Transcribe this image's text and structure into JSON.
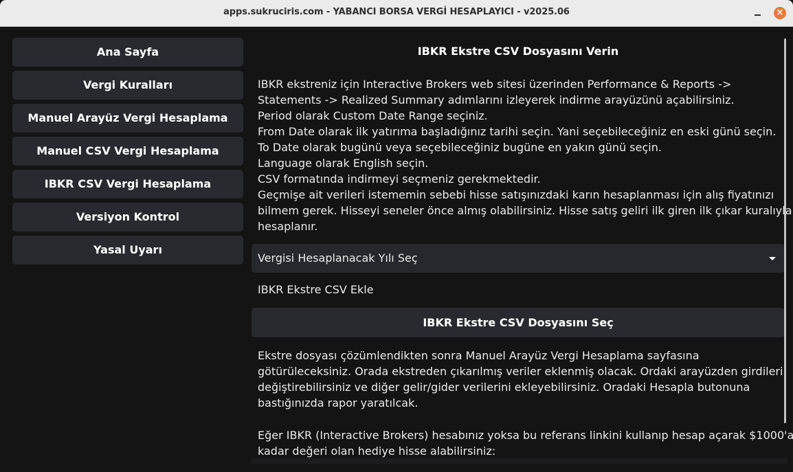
{
  "window": {
    "title": "apps.sukruciris.com - YABANCI BORSA VERGİ HESAPLAYICI - v2025.06",
    "minimize_glyph": "",
    "close_glyph": "×"
  },
  "sidebar": {
    "items": [
      {
        "label": "Ana Sayfa"
      },
      {
        "label": "Vergi Kuralları"
      },
      {
        "label": "Manuel Arayüz Vergi Hesaplama"
      },
      {
        "label": "Manuel CSV Vergi Hesaplama"
      },
      {
        "label": "IBKR CSV Vergi Hesaplama"
      },
      {
        "label": "Versiyon Kontrol"
      },
      {
        "label": "Yasal Uyarı"
      }
    ]
  },
  "main": {
    "heading": "IBKR Ekstre CSV Dosyasını Verin",
    "instructions": [
      "IBKR ekstreniz için Interactive Brokers web sitesi üzerinden Performance & Reports ->",
      "Statements -> Realized Summary adımlarını izleyerek indirme arayüzünü açabilirsiniz.",
      "Period olarak Custom Date Range seçiniz.",
      "From Date olarak ilk yatırıma başladığınız tarihi seçin. Yani seçebileceğiniz en eski günü seçin.",
      "To Date olarak bugünü veya seçebileceğiniz bugüne en yakın günü seçin.",
      "Language olarak English seçin.",
      "CSV formatında indirmeyi seçmeniz gerekmektedir.",
      "Geçmişe ait verileri istememin sebebi hisse satışınızdaki karın hesaplanması için alış fiyatınızı",
      "bilmem gerek. Hisseyi seneler önce almış olabilirsiniz. Hisse satış geliri ilk giren ilk çıkar kuralıyla",
      "hesaplanır."
    ],
    "year_select": {
      "label": "Vergisi Hesaplanacak Yılı Seç"
    },
    "csv_label": "IBKR Ekstre CSV Ekle",
    "file_button_label": "IBKR Ekstre CSV Dosyasını Seç",
    "after_text": [
      "Ekstre dosyası çözümlendikten sonra Manuel Arayüz Vergi Hesaplama sayfasına",
      "götürüleceksiniz. Orada ekstreden çıkarılmış veriler eklenmiş olacak. Ordaki arayüzden girdileri",
      "değiştirebilirsiniz ve diğer gelir/gider verilerini ekleyebilirsiniz. Oradaki Hesapla butonuna",
      "bastığınızda rapor yaratılcak."
    ],
    "referral_text": [
      "Eğer IBKR (Interactive Brokers) hesabınız yoksa bu referans linkini kullanıp hesap açarak $1000'a",
      "kadar değeri olan hediye hisse alabilirsiniz:"
    ]
  }
}
